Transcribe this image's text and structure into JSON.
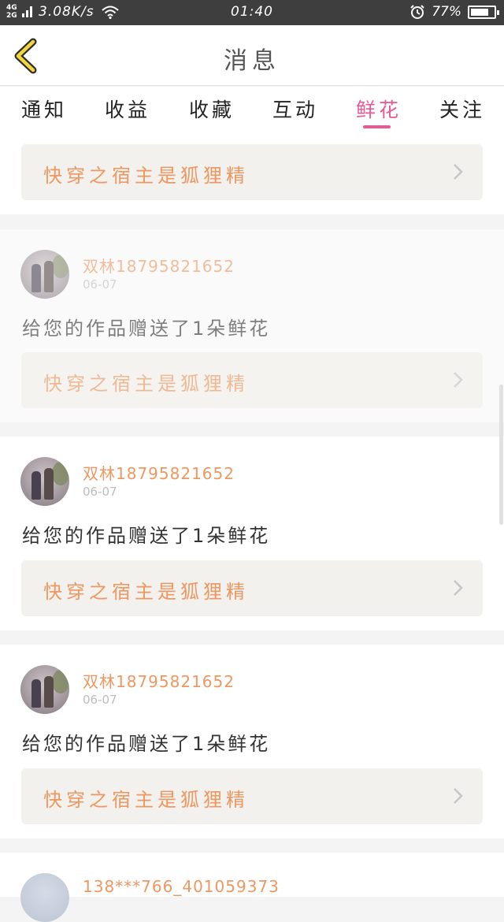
{
  "status_bar": {
    "network": "4G¹ 2G",
    "speed": "3.08K/s",
    "time": "01:40",
    "battery": "77%",
    "battery_level": 0.77
  },
  "header": {
    "title": "消息"
  },
  "tabs": [
    {
      "label": "通知",
      "active": false
    },
    {
      "label": "收益",
      "active": false
    },
    {
      "label": "收藏",
      "active": false
    },
    {
      "label": "互动",
      "active": false
    },
    {
      "label": "鲜花",
      "active": true
    },
    {
      "label": "关注",
      "active": false
    }
  ],
  "messages": [
    {
      "user": "",
      "date": "",
      "text": "",
      "book": "快穿之宿主是狐狸精"
    },
    {
      "user": "双林18795821652",
      "date": "06-07",
      "text": "给您的作品赠送了1朵鲜花",
      "book": "快穿之宿主是狐狸精"
    },
    {
      "user": "双林18795821652",
      "date": "06-07",
      "text": "给您的作品赠送了1朵鲜花",
      "book": "快穿之宿主是狐狸精"
    },
    {
      "user": "双林18795821652",
      "date": "06-07",
      "text": "给您的作品赠送了1朵鲜花",
      "book": "快穿之宿主是狐狸精"
    },
    {
      "user": "138***766_401059373",
      "date": "",
      "text": "",
      "book": ""
    }
  ],
  "colors": {
    "accent": "#e95895",
    "name": "#ee9760",
    "statusbar": "#3e3e3e"
  },
  "icons": {
    "back": "chevron-left-icon",
    "book_arrow": "chevron-right-icon",
    "wifi": "wifi-icon",
    "alarm": "alarm-icon",
    "battery": "battery-icon"
  }
}
